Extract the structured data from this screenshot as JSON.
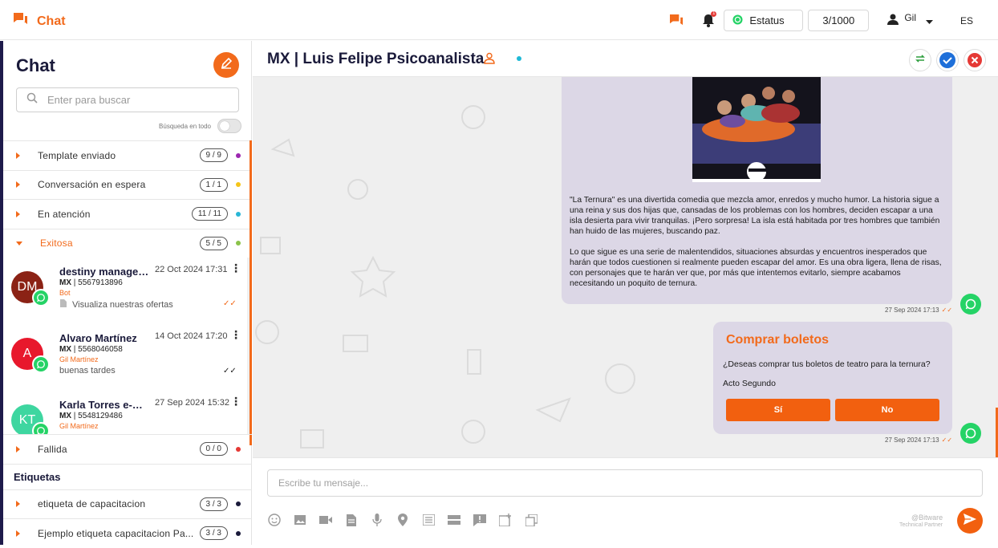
{
  "topbar": {
    "brand_title": "Chat",
    "notification_count": "1",
    "status_label": "Estatus",
    "counter": "3/1000",
    "user_name": "Gil",
    "language": "ES"
  },
  "sidebar": {
    "title": "Chat",
    "search_placeholder": "Enter para buscar",
    "toggle_label": "Búsqueda en todo",
    "categories": [
      {
        "label": "Template enviado",
        "count": "9 / 9",
        "color": "#9c27b0"
      },
      {
        "label": "Conversación en espera",
        "count": "1 / 1",
        "color": "#f5c518"
      },
      {
        "label": "En atención",
        "count": "11 / 11",
        "color": "#29b6d6"
      },
      {
        "label": "Exitosa",
        "count": "5 / 5",
        "color": "#8bc34a"
      }
    ],
    "conversations": [
      {
        "initials": "DM",
        "avatar_color": "#8b2215",
        "name": "destiny manager...",
        "date": "22 Oct 2024 17:31",
        "phone_country": "MX",
        "phone": "5567913896",
        "agent": "Bot",
        "preview": "Visualiza nuestras ofertas",
        "tick_color": "#f26a1b"
      },
      {
        "initials": "A",
        "avatar_color": "#e8182c",
        "name": "Alvaro Martínez",
        "date": "14 Oct 2024 17:20",
        "phone_country": "MX",
        "phone": "5568046058",
        "agent": "Gil Martínez",
        "preview": "buenas tardes",
        "tick_color": "#222222"
      },
      {
        "initials": "KT",
        "avatar_color": "#3ed6a0",
        "name": "Karla Torres e-Bi...",
        "date": "27 Sep 2024 15:32",
        "phone_country": "MX",
        "phone": "5548129486",
        "agent": "Gil Martínez",
        "preview": "",
        "tick_color": "#222222"
      }
    ],
    "failed_category": {
      "label": "Fallida",
      "count": "0 / 0",
      "color": "#e53935"
    },
    "tags_title": "Etiquetas",
    "tags": [
      {
        "label": "etiqueta de capacitacion",
        "count": "3 / 3",
        "color": "#1a1a3a"
      },
      {
        "label": "Ejemplo etiqueta capacitacion Pa...",
        "count": "3 / 3",
        "color": "#1a1a3a"
      }
    ]
  },
  "chat": {
    "title": "MX | Luis Felipe Psicoanalista",
    "messages": [
      {
        "paragraph1": " \"La Ternura\" es una divertida comedia que mezcla amor, enredos y mucho humor. La historia sigue a una reina y sus dos hijas que, cansadas de los problemas con los hombres, deciden escapar a una isla desierta para vivir tranquilas. ¡Pero sorpresa! La isla está habitada por tres hombres que también han huido de las mujeres, buscando paz.",
        "paragraph2": "Lo que sigue es una serie de malentendidos, situaciones absurdas y encuentros inesperados que harán que todos cuestionen si realmente pueden escapar del amor. Es una obra ligera, llena de risas, con personajes que te harán ver que, por más que intentemos evitarlo, siempre acabamos necesitando un poquito de ternura.",
        "timestamp": "27 Sep 2024 17:13"
      },
      {
        "title": "Comprar boletos",
        "question": "¿Deseas comprar tus boletos de teatro para la ternura?",
        "signature": "Acto Segundo",
        "button_yes": "Sí",
        "button_no": "No",
        "timestamp": "27 Sep 2024 17:13"
      }
    ]
  },
  "composer": {
    "placeholder": "Escribe tu mensaje...",
    "partner_line1": "@Bitware",
    "partner_line2": "Technical Partner"
  },
  "colors": {
    "accent": "#f26a1b",
    "bubble": "#dcd7e6",
    "whatsapp": "#25d366"
  }
}
